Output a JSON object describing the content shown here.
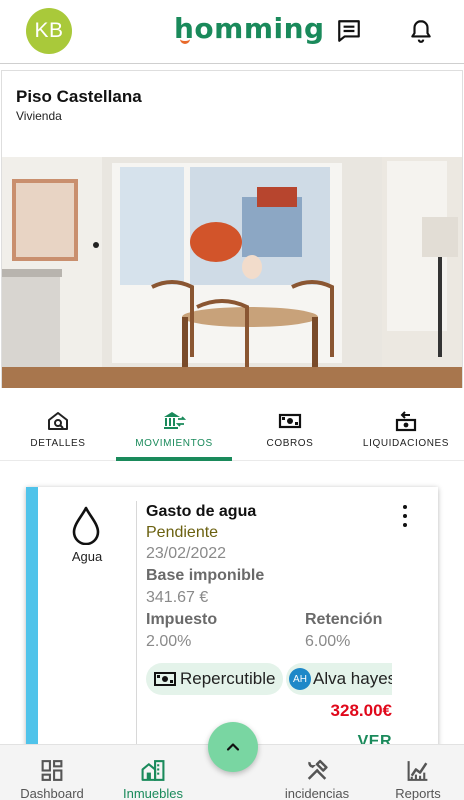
{
  "header": {
    "avatar_initials": "KB",
    "logo_text": "homming",
    "brand_color": "#1a8a5b",
    "icons": [
      "chat-icon",
      "bell-icon"
    ]
  },
  "property": {
    "title": "Piso Castellana",
    "type": "Vivienda"
  },
  "tabs": [
    {
      "label": "DETALLES",
      "icon": "house-search-icon",
      "active": false
    },
    {
      "label": "MOVIMIENTOS",
      "icon": "bank-transfer-icon",
      "active": true
    },
    {
      "label": "COBROS",
      "icon": "cash-icon",
      "active": false
    },
    {
      "label": "LIQUIDACIONES",
      "icon": "cash-refund-icon",
      "active": false
    }
  ],
  "movement": {
    "category": "Agua",
    "category_icon": "water-drop-icon",
    "title": "Gasto de agua",
    "status": "Pendiente",
    "date": "23/02/2022",
    "base_label": "Base imponible",
    "base_value": "341.67 €",
    "tax_label": "Impuesto",
    "tax_value": "2.00%",
    "retention_label": "Retención",
    "retention_value": "6.00%",
    "chip_repercutible": "Repercutible",
    "chip_owner_initials": "AH",
    "chip_owner_name": "Alva hayes",
    "total": "328.00€",
    "view_label": "VER",
    "stripe_color": "#4fc3ea",
    "total_color": "#e0081b"
  },
  "nav": [
    {
      "label": "Dashboard",
      "icon": "dashboard-icon",
      "active": false
    },
    {
      "label": "Inmuebles",
      "icon": "buildings-icon",
      "active": true
    },
    {
      "label": "incidencias",
      "icon": "tools-icon",
      "active": false
    },
    {
      "label": "Reports",
      "icon": "chart-icon",
      "active": false
    }
  ],
  "fab_icon": "chevron-up-icon"
}
